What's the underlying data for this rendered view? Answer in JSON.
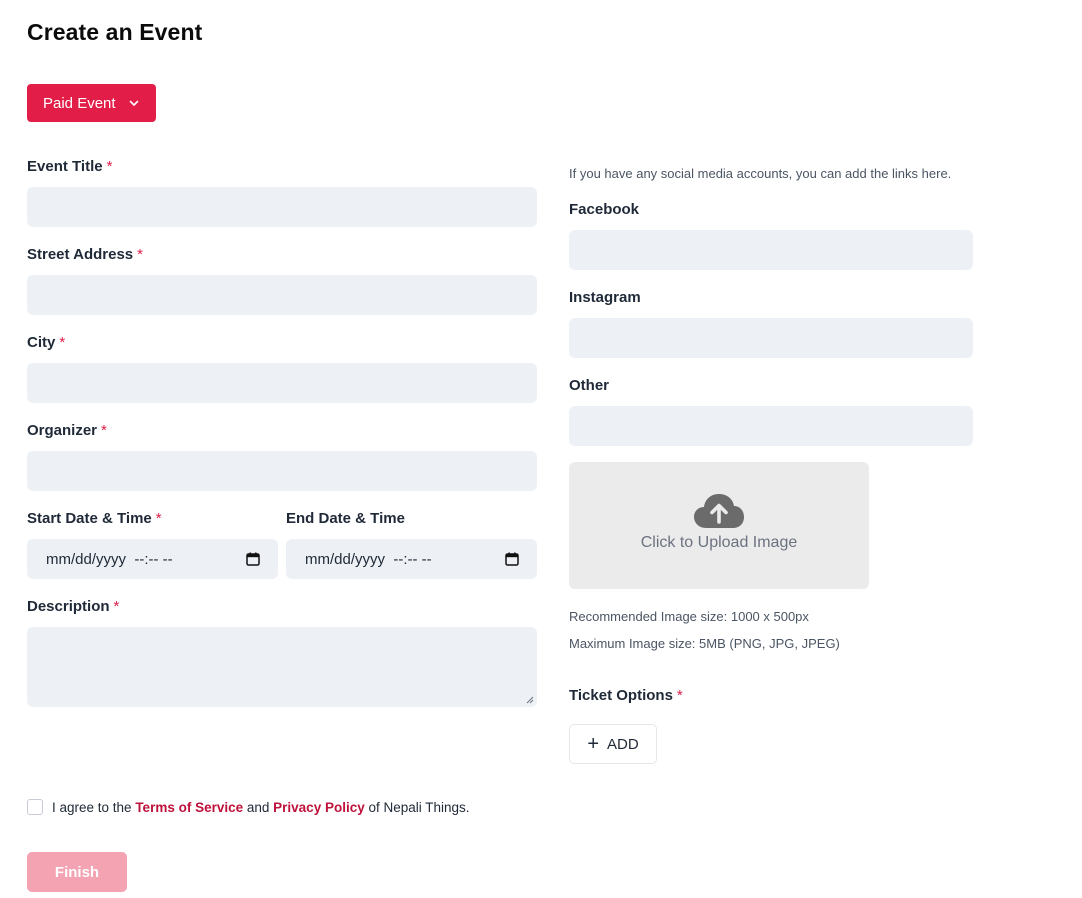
{
  "page_title": "Create an Event",
  "event_type": {
    "selected": "Paid Event"
  },
  "form": {
    "event_title": {
      "label": "Event Title",
      "required_mark": "*",
      "value": ""
    },
    "street_address": {
      "label": "Street Address",
      "required_mark": "*",
      "value": ""
    },
    "city": {
      "label": "City",
      "required_mark": "*",
      "value": ""
    },
    "organizer": {
      "label": "Organizer",
      "required_mark": "*",
      "value": ""
    },
    "start_datetime": {
      "label": "Start Date & Time",
      "required_mark": "*",
      "display": "mm/dd/yyyy  --:-- --"
    },
    "end_datetime": {
      "label": "End Date & Time",
      "display": "mm/dd/yyyy  --:-- --"
    },
    "description": {
      "label": "Description",
      "required_mark": "*",
      "value": ""
    }
  },
  "social": {
    "hint": "If you have any social media accounts, you can add the links here.",
    "facebook": {
      "label": "Facebook",
      "value": ""
    },
    "instagram": {
      "label": "Instagram",
      "value": ""
    },
    "other": {
      "label": "Other",
      "value": ""
    }
  },
  "upload": {
    "text": "Click to Upload Image",
    "recommended": "Recommended Image size: 1000 x 500px",
    "maximum": "Maximum Image size: 5MB (PNG, JPG, JPEG)",
    "icon": "cloud-upload-icon"
  },
  "tickets": {
    "label": "Ticket Options",
    "required_mark": "*",
    "add_label": "ADD"
  },
  "agreement": {
    "prefix": "I agree to the ",
    "terms": "Terms of Service",
    "middle": " and ",
    "privacy": "Privacy Policy",
    "suffix": " of Nepali Things."
  },
  "finish_label": "Finish",
  "colors": {
    "accent": "#e11d48",
    "field_bg": "#edf1f6",
    "finish_disabled": "#f4a3b3",
    "link": "#be123c"
  }
}
